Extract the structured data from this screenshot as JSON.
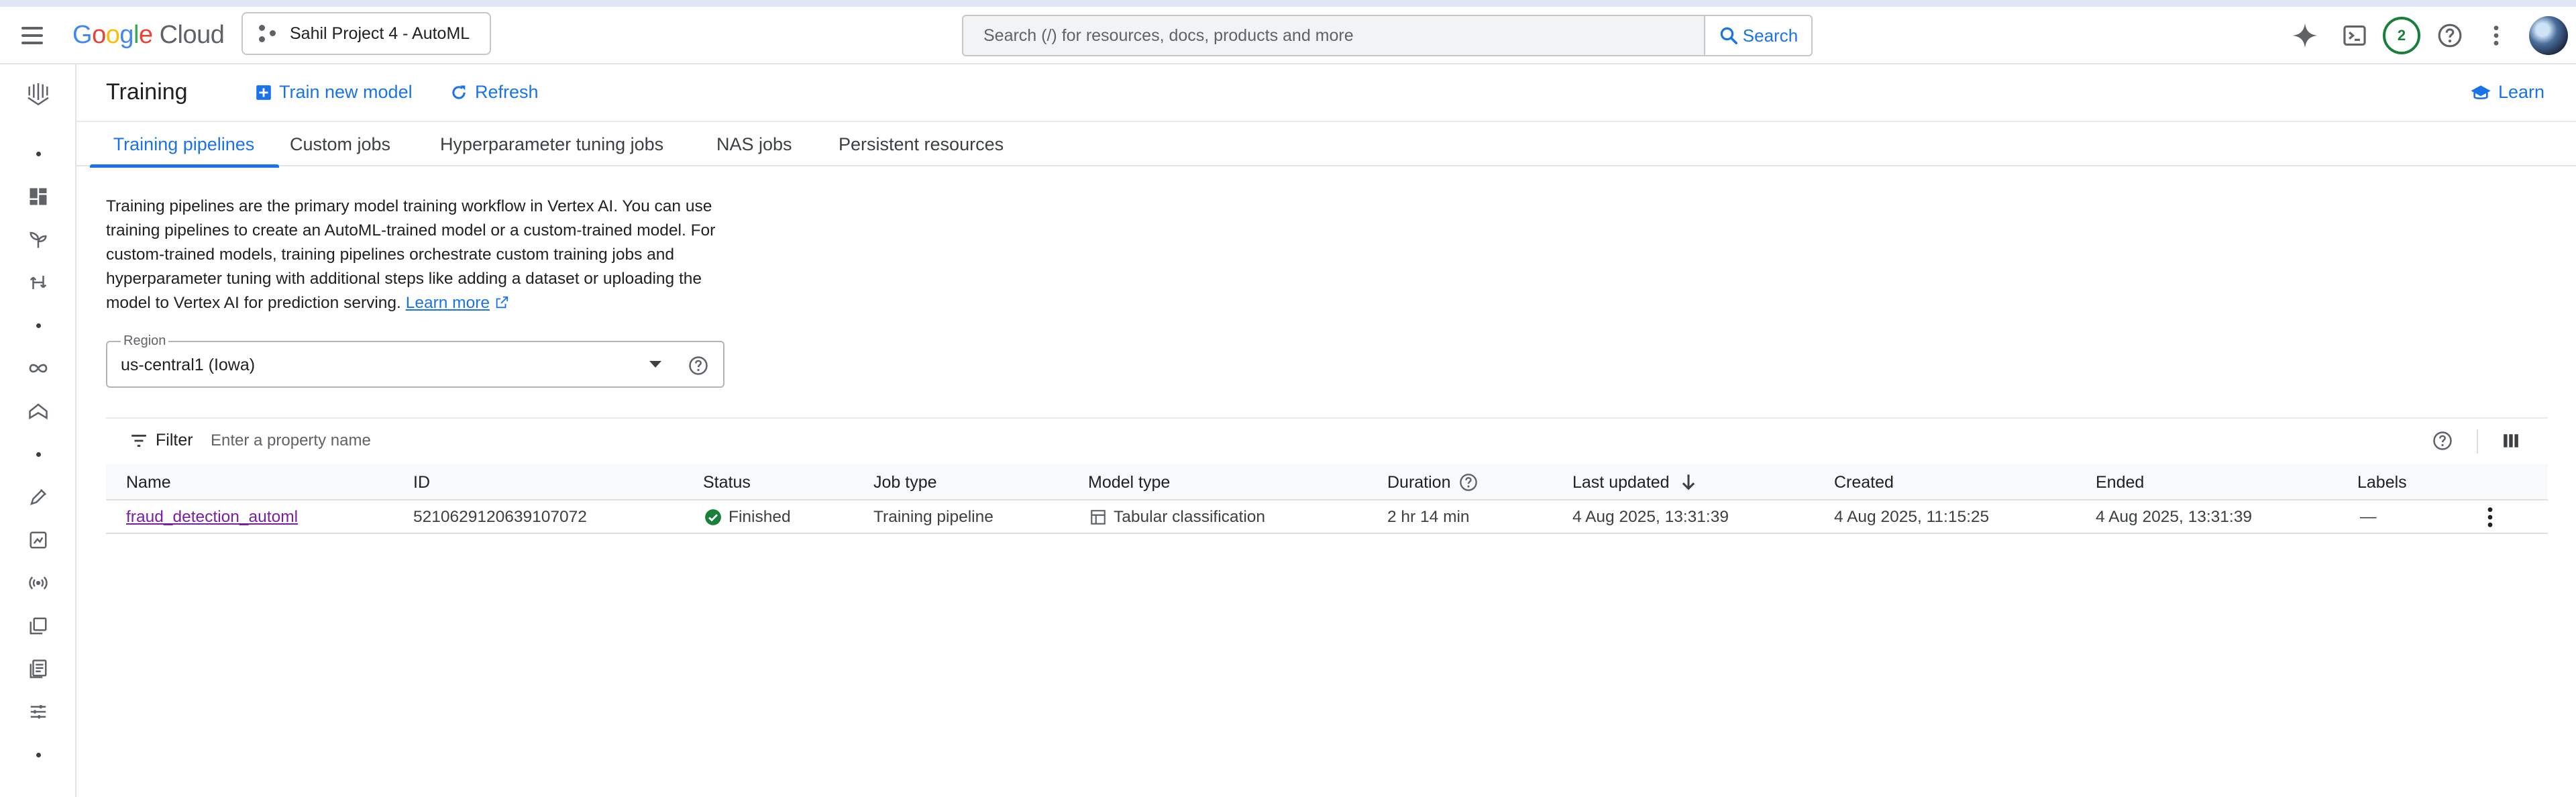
{
  "header": {
    "logo_text": "Google Cloud",
    "project_name": "Sahil Project 4 - AutoML",
    "search_placeholder": "Search (/) for resources, docs, products and more",
    "search_button": "Search",
    "notifications_count": "2"
  },
  "page": {
    "title": "Training",
    "train_new_model": "Train new model",
    "refresh": "Refresh",
    "learn": "Learn"
  },
  "tabs": [
    {
      "label": "Training pipelines",
      "active": true
    },
    {
      "label": "Custom jobs",
      "active": false
    },
    {
      "label": "Hyperparameter tuning jobs",
      "active": false
    },
    {
      "label": "NAS jobs",
      "active": false
    },
    {
      "label": "Persistent resources",
      "active": false
    }
  ],
  "description": {
    "text": "Training pipelines are the primary model training workflow in Vertex AI. You can use training pipelines to create an AutoML-trained model or a custom-trained model. For custom-trained models, training pipelines orchestrate custom training jobs and hyperparameter tuning with additional steps like adding a dataset or uploading the model to Vertex AI for prediction serving.",
    "learn_more": "Learn more"
  },
  "region": {
    "label": "Region",
    "value": "us-central1 (Iowa)"
  },
  "filter": {
    "label": "Filter",
    "placeholder": "Enter a property name"
  },
  "table": {
    "columns": [
      "Name",
      "ID",
      "Status",
      "Job type",
      "Model type",
      "Duration",
      "Last updated",
      "Created",
      "Ended",
      "Labels"
    ],
    "rows": [
      {
        "name": "fraud_detection_automl",
        "id": "5210629120639107072",
        "status": "Finished",
        "job_type": "Training pipeline",
        "model_type": "Tabular classification",
        "duration": "2 hr 14 min",
        "last_updated": "4 Aug 2025, 13:31:39",
        "created": "4 Aug 2025, 11:15:25",
        "ended": "4 Aug 2025, 13:31:39",
        "labels": "—"
      }
    ]
  },
  "colors": {
    "accent": "#1a73e8",
    "success": "#188038",
    "link_visited": "#7b1fa2"
  },
  "icons": {
    "rail": [
      "vertex-ai-logo-icon",
      "dashboard-icon",
      "sprout-icon",
      "workflow-icon",
      "infinity-icon",
      "model-garden-icon",
      "pen-icon",
      "image-chart-icon",
      "broadcast-icon",
      "library-icon",
      "notebook-icon",
      "tune-icon"
    ]
  }
}
